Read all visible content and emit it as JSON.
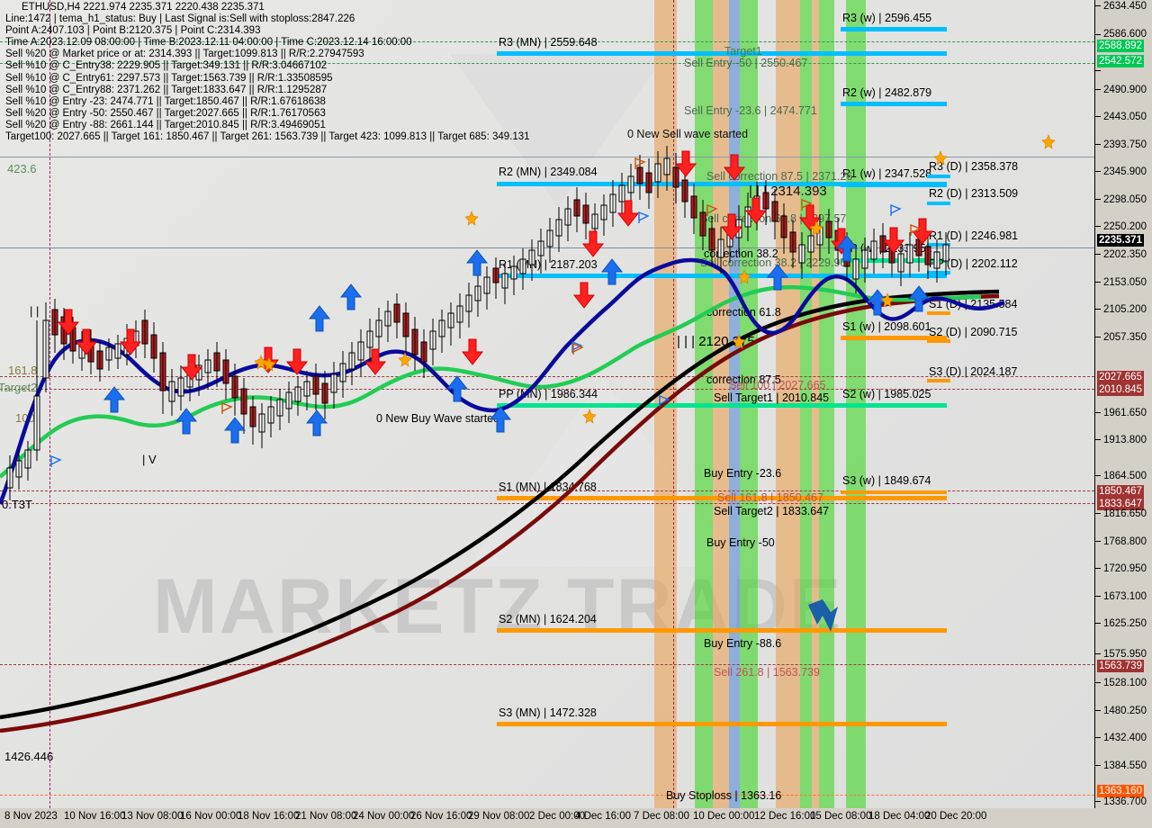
{
  "header": {
    "symbol_line": "ETHUSD,H4  2221.974 2235.371 2220.438 2235.371",
    "lines": [
      "Line:1472 |  tema_h1_status: Buy | Last Signal is:Sell with stoploss:2847.226",
      "Point A:2407.103 | Point B:2120.375 | Point C:2314.393",
      "Time A:2023.12.09 08:00:00 | Time B:2023.12.11 04:00:00 | Time C:2023.12.14 16:00:00",
      "Sell %20 @ Market price or at: 2314.393 || Target:1099.813 || R/R:2.27947593",
      "Sell %10 @ C_Entry38: 2229.905 || Target:349.131 || R/R:3.04667102",
      "Sell %10 @ C_Entry61: 2297.573 || Target:1563.739 || R/R:1.33508595",
      "Sell %10 @ C_Entry88: 2371.262 || Target:1833.647 || R/R:1.1295287",
      "Sell %10 @ Entry -23: 2474.771 || Target:1850.467 || R/R:1.67618638",
      "Sell %20 @ Entry -50: 2550.467 || Target:2027.665 || R/R:1.76170563",
      "Sell %20 @ Entry -88: 2661.144 || Target:2010.845 || R/R:3.49469051",
      "Target100: 2027.665 || Target 161: 1850.467 || Target 261: 1563.739 || Target 423: 1099.813 || Target 685: 349.131"
    ]
  },
  "chart_data": {
    "type": "line",
    "title": "ETHUSD,H4",
    "xlabel": "",
    "ylabel": "",
    "ylim": [
      1336.7,
      2634.45
    ],
    "grid": false,
    "price_axis_ticks": [
      "2634.450",
      "2586.600",
      "2490.900",
      "2443.050",
      "2393.750",
      "2345.900",
      "2298.050",
      "2250.200",
      "2202.350",
      "2153.050",
      "2105.200",
      "2057.350",
      "1961.650",
      "1913.800",
      "1864.500",
      "1816.650",
      "1768.800",
      "1720.950",
      "1673.100",
      "1625.250",
      "1575.950",
      "1528.100",
      "1480.250",
      "1432.400",
      "1384.550",
      "1336.700"
    ],
    "price_axis_boxes": [
      {
        "value": "2588.892",
        "color": "#00c853",
        "text": "#ffffff"
      },
      {
        "value": "2542.572",
        "color": "#00c853",
        "text": "#ffffff"
      },
      {
        "value": "2235.371",
        "color": "#000000",
        "text": "#ffffff"
      },
      {
        "value": "2027.665",
        "color": "#a03434",
        "text": "#ffffff"
      },
      {
        "value": "2010.845",
        "color": "#a03434",
        "text": "#ffffff"
      },
      {
        "value": "1850.467",
        "color": "#a03434",
        "text": "#ffffff"
      },
      {
        "value": "1833.647",
        "color": "#a03434",
        "text": "#ffffff"
      },
      {
        "value": "1563.739",
        "color": "#a03434",
        "text": "#ffffff"
      },
      {
        "value": "1363.160",
        "color": "#ff5500",
        "text": "#ffffff"
      }
    ],
    "time_axis_ticks": [
      "8 Nov 2023",
      "10 Nov 16:00",
      "13 Nov 08:00",
      "16 Nov 00:00",
      "18 Nov 16:00",
      "21 Nov 08:00",
      "24 Nov 00:00",
      "26 Nov 16:00",
      "29 Nov 08:00",
      "2 Dec 00:00",
      "4 Dec 16:00",
      "7 Dec 08:00",
      "10 Dec 00:00",
      "12 Dec 16:00",
      "15 Dec 08:00",
      "18 Dec 04:00",
      "20 Dec 20:00"
    ],
    "pivot_levels": [
      {
        "label": "R3 (MN) | 2559.648",
        "color": "#00bfff"
      },
      {
        "label": "R2 (MN) | 2349.084",
        "color": "#00bfff"
      },
      {
        "label": "R1 (MN) | 2187.203",
        "color": "#00bfff"
      },
      {
        "label": "PP (MN) | 1986.344",
        "color": "#00e58f"
      },
      {
        "label": "S1 (MN) | 1834.768",
        "color": "#ff9900"
      },
      {
        "label": "S2 (MN) | 1624.204",
        "color": "#ff9900"
      },
      {
        "label": "S3 (MN) | 1472.328",
        "color": "#ff9900"
      },
      {
        "label": "R3 (w) | 2596.455",
        "color": "#00bfff"
      },
      {
        "label": "R2 (w) | 2482.879",
        "color": "#00bfff"
      },
      {
        "label": "R1 (w) | 2347.528",
        "color": "#00bfff"
      },
      {
        "label": "PP (w) | 2233.952",
        "color": "#00e58f"
      },
      {
        "label": "S1 (w) | 2098.601",
        "color": "#ff9900"
      },
      {
        "label": "S2 (w) | 1985.025",
        "color": "#00e58f"
      },
      {
        "label": "S3 (w) | 1849.674",
        "color": "#ff9900"
      },
      {
        "label": "R3 (D) | 2358.378",
        "color": "#00bfff"
      },
      {
        "label": "R2 (D) | 2313.509",
        "color": "#00bfff"
      },
      {
        "label": "R1 (D) | 2246.981",
        "color": "#00bfff"
      },
      {
        "label": "PP (D) | 2202.112",
        "color": "#00bfff"
      },
      {
        "label": "S1 (D) | 2135.584",
        "color": "#ff9900"
      },
      {
        "label": "S2 (D) | 2090.715",
        "color": "#ff9900"
      },
      {
        "label": "S3 (D) | 2024.187",
        "color": "#ff9900"
      }
    ],
    "annotations": [
      "Target1",
      "Sell Entry -50 | 2550.467",
      "Sell Entry -23.6 | 2474.771",
      "0 New Sell wave started",
      "Sell correction 87.5 | 2371.26",
      "| | | 2314.393",
      "Sell correction 61.8 | 2297.57",
      "Sell correction 38.2 | 2229.90",
      "correction 38.2",
      "correction 61.8",
      "| | | 2120.375",
      "correction 87.5",
      "Sell 100 | 2027.665",
      "Sell Target1 | 2010.845",
      "0 New Buy Wave started",
      "Buy Entry -23.6",
      "Sell 161.8 | 1850.467",
      "Sell Target2 | 1833.647",
      "Buy Entry -50",
      "Buy Entry -88.6",
      "Sell 261.8 | 1563.739",
      "Buy Stoploss | 1363.16",
      "423.6",
      "161.8",
      "Target2",
      "100",
      "0.T3T",
      "1426.446",
      "| V",
      "| |"
    ]
  },
  "levels": {
    "r3mn": {
      "label": "R3 (MN) | 2559.648"
    },
    "r2mn": {
      "label": "R2 (MN) | 2349.084"
    },
    "r1mn": {
      "label": "R1 (MN) | 2187.203"
    },
    "ppmn": {
      "label": "PP (MN) | 1986.344"
    },
    "s1mn": {
      "label": "S1 (MN) | 1834.768"
    },
    "s2mn": {
      "label": "S2 (MN) | 1624.204"
    },
    "s3mn": {
      "label": "S3 (MN) | 1472.328"
    },
    "r3w": {
      "label": "R3 (w) | 2596.455"
    },
    "r2w": {
      "label": "R2 (w) | 2482.879"
    },
    "r1w": {
      "label": "R1 (w) | 2347.528"
    },
    "ppw": {
      "label": "PP (w) | 2233.952"
    },
    "s1w": {
      "label": "S1 (w) | 2098.601"
    },
    "s2w": {
      "label": "S2 (w) | 1985.025"
    },
    "s3w": {
      "label": "S3 (w) | 1849.674"
    },
    "r3d": {
      "label": "R3 (D) | 2358.378"
    },
    "r2d": {
      "label": "R2 (D) | 2313.509"
    },
    "r1d": {
      "label": "R1 (D) | 2246.981"
    },
    "ppd": {
      "label": "PP (D) | 2202.112"
    },
    "s1d": {
      "label": "S1 (D) | 2135.584"
    },
    "s2d": {
      "label": "S2 (D) | 2090.715"
    },
    "s3d": {
      "label": "S3 (D) | 2024.187"
    }
  },
  "notes": {
    "target1": "Target1",
    "sell_entry_50": "Sell Entry -50 | 2550.467",
    "sell_entry_236": "Sell Entry -23.6 | 2474.771",
    "new_sell_wave": "0 New Sell wave started",
    "sell_corr_875": "Sell correction 87.5 | 2371.26",
    "price_c": "| | | 2314.393",
    "sell_corr_618": "Sell correction 61.8 | 2297.57",
    "sell_corr_382": "Sell correction 38.2 | 2229.90",
    "corr_382": "correction 38.2",
    "corr_618": "correction 61.8",
    "price_b": "| | | 2120.375",
    "corr_875": "correction 87.5",
    "sell_100": "Sell 100 | 2027.665",
    "sell_target1": "Sell Target1 | 2010.845",
    "new_buy_wave": "0 New Buy Wave started",
    "buy_entry_236": "Buy Entry -23.6",
    "sell_1618": "Sell 161.8 | 1850.467",
    "sell_target2": "Sell Target2 | 1833.647",
    "buy_entry_50": "Buy Entry -50",
    "buy_entry_886": "Buy Entry -88.6",
    "sell_2618": "Sell  261.8 | 1563.739",
    "buy_stoploss": "Buy Stoploss | 1363.16",
    "fib_4236": "423.6",
    "fib_1618": "161.8",
    "target2": "Target2",
    "fib_100": "100",
    "fib_t3t": "0.T3T",
    "low_price": "1426.446",
    "wave_v": "| V",
    "wave_ii": "| |"
  },
  "watermark": {
    "left": "MARKETZ",
    "right": "TRADE"
  },
  "colors": {
    "pivot_blue": "#00bfff",
    "pivot_green": "#00e58f",
    "pivot_orange": "#ff9900",
    "band_green": "#44d62c",
    "band_orange": "#e8a45a",
    "band_blue": "#5a8fd6",
    "dashed_red": "#9c3b3b",
    "dashed_green": "#2e9e4f",
    "crosshair": "#a0206a",
    "ma_blue": "#0a0a9c",
    "ma_green": "#22cc55",
    "ma_black": "#000000",
    "ma_darkred": "#7a0a0a",
    "arrow_sell": "#ff2222",
    "arrow_buy": "#1a6ef0",
    "star": "#ffa500"
  }
}
